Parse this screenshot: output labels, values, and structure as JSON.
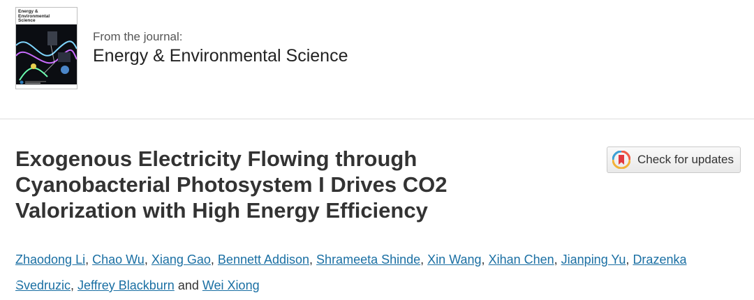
{
  "journal": {
    "cover_title_lines": [
      "Energy &",
      "Environmental",
      "Science"
    ],
    "label": "From the journal:",
    "name": "Energy & Environmental Science"
  },
  "article": {
    "title_lines": [
      "Exogenous Electricity Flowing through",
      "Cyanobacterial Photosystem I Drives CO2",
      "Valorization with High Energy Efficiency"
    ]
  },
  "check_updates": {
    "label": "Check for updates",
    "icon": "check-for-updates-icon"
  },
  "authors": {
    "names": [
      "Zhaodong Li",
      "Chao Wu",
      "Xiang Gao",
      "Bennett Addison",
      "Shrameeta Shinde",
      "Xin Wang",
      "Xihan Chen",
      "Jianping Yu",
      "Drazenka Svedruzic",
      "Jeffrey Blackburn",
      "Wei Xiong"
    ],
    "conjunction": "and"
  },
  "colors": {
    "link": "#1a6fa3",
    "title": "#333333",
    "divider": "#dcdcdc"
  }
}
